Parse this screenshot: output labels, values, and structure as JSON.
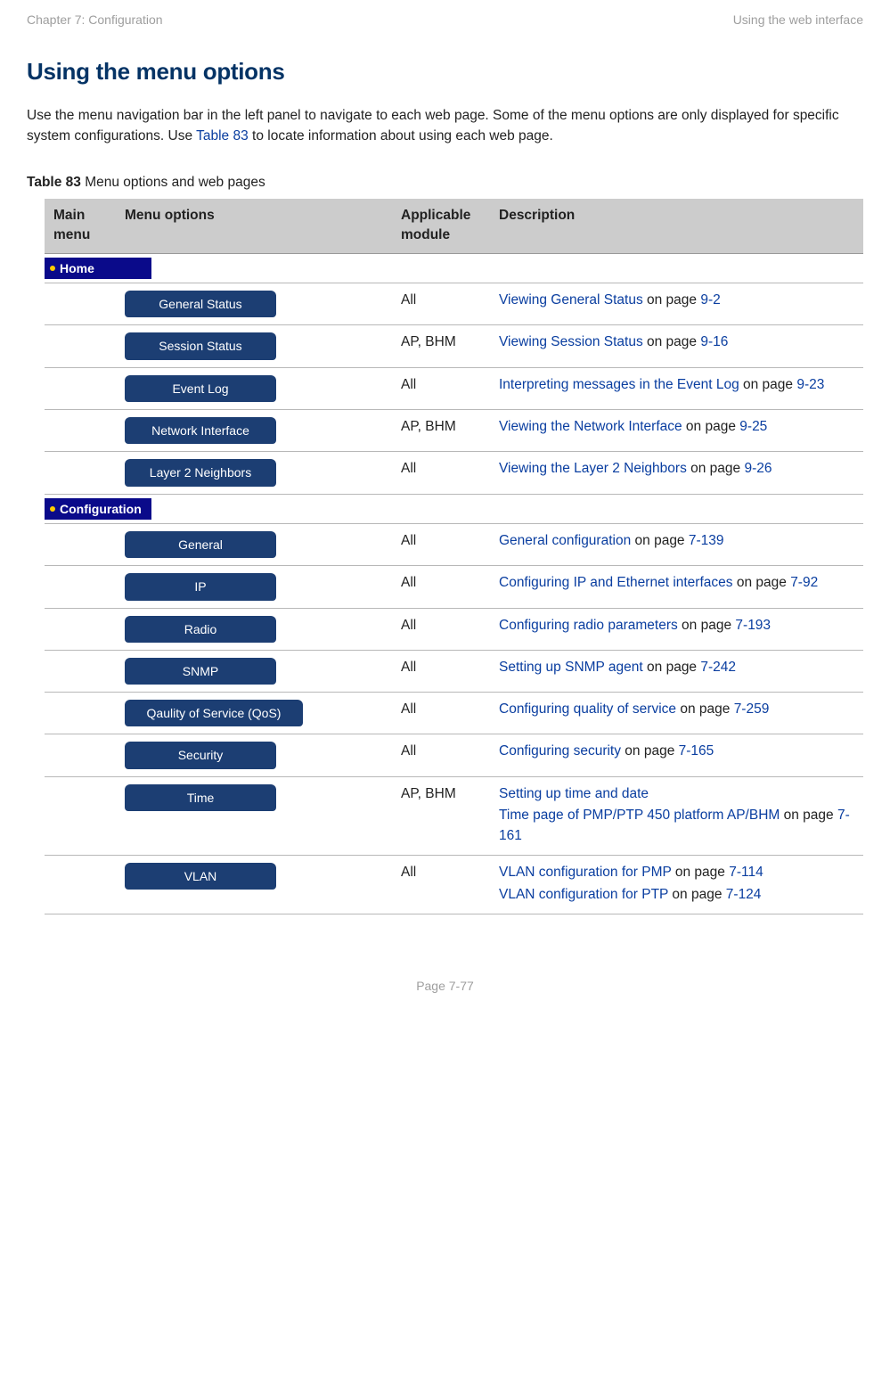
{
  "header": {
    "left": "Chapter 7:  Configuration",
    "right": "Using the web interface"
  },
  "page_title": "Using the menu options",
  "intro": {
    "t1": "Use the menu navigation bar in the left panel to navigate to each web page. Some of the menu options are only displayed for specific system configurations. Use ",
    "link": "Table 83",
    "t2": " to locate information about using each web page."
  },
  "table_caption": {
    "bold": "Table 83",
    "rest": " Menu options and web pages"
  },
  "columns": {
    "c1": "Main menu",
    "c2": "Menu options",
    "c3": "Applicable module",
    "c4": "Description"
  },
  "home_label": "Home",
  "config_label": "Configuration",
  "rows": [
    {
      "menu": "General Status",
      "module": "All",
      "descs": [
        {
          "link": "Viewing General Status",
          "mid": " on page ",
          "page": "9-2"
        }
      ]
    },
    {
      "menu": "Session Status",
      "module": "AP, BHM",
      "descs": [
        {
          "link": "Viewing Session Status",
          "mid": " on page ",
          "page": "9-16"
        }
      ]
    },
    {
      "menu": "Event Log",
      "module": "All",
      "descs": [
        {
          "link": "Interpreting messages in the Event Log",
          "mid": " on page ",
          "page": "9-23"
        }
      ]
    },
    {
      "menu": "Network Interface",
      "module": "AP, BHM",
      "descs": [
        {
          "link": "Viewing the Network Interface",
          "mid": " on page ",
          "page": "9-25"
        }
      ]
    },
    {
      "menu": "Layer 2 Neighbors",
      "module": "All",
      "descs": [
        {
          "link": "Viewing the Layer 2 Neighbors",
          "mid": " on page ",
          "page": "9-26"
        }
      ]
    }
  ],
  "config_rows": [
    {
      "menu": "General",
      "module": "All",
      "descs": [
        {
          "link": "General configuration",
          "mid": " on page ",
          "page": "7-139"
        }
      ]
    },
    {
      "menu": "IP",
      "module": "All",
      "descs": [
        {
          "link": "Configuring IP and Ethernet interfaces",
          "mid": " on page ",
          "page": "7-92"
        }
      ]
    },
    {
      "menu": "Radio",
      "module": "All",
      "descs": [
        {
          "link": "Configuring radio parameters",
          "mid": " on page ",
          "page": "7-193"
        }
      ]
    },
    {
      "menu": "SNMP",
      "module": "All",
      "descs": [
        {
          "link": "Setting up SNMP agent",
          "mid": " on page ",
          "page": "7-242"
        }
      ]
    },
    {
      "menu": "Qaulity of Service (QoS)",
      "module": "All",
      "wide": true,
      "descs": [
        {
          "link": "Configuring quality of service",
          "mid": " on page ",
          "page": "7-259"
        }
      ]
    },
    {
      "menu": "Security",
      "module": "All",
      "descs": [
        {
          "link": "Configuring security",
          "mid": " on page ",
          "page": "7-165"
        }
      ]
    },
    {
      "menu": "Time",
      "module": "AP, BHM",
      "descs": [
        {
          "link": "Setting up time and date",
          "mid": "",
          "page": ""
        },
        {
          "link": "Time page of PMP/PTP 450 platform AP/BHM",
          "mid": " on page ",
          "page": "7-161"
        }
      ]
    },
    {
      "menu": "VLAN",
      "module": "All",
      "descs": [
        {
          "link": "VLAN configuration for PMP",
          "mid": " on page ",
          "page": "7-114"
        },
        {
          "link": "VLAN configuration for PTP",
          "mid": " on page ",
          "page": "7-124"
        }
      ]
    }
  ],
  "footer": "Page 7-77"
}
